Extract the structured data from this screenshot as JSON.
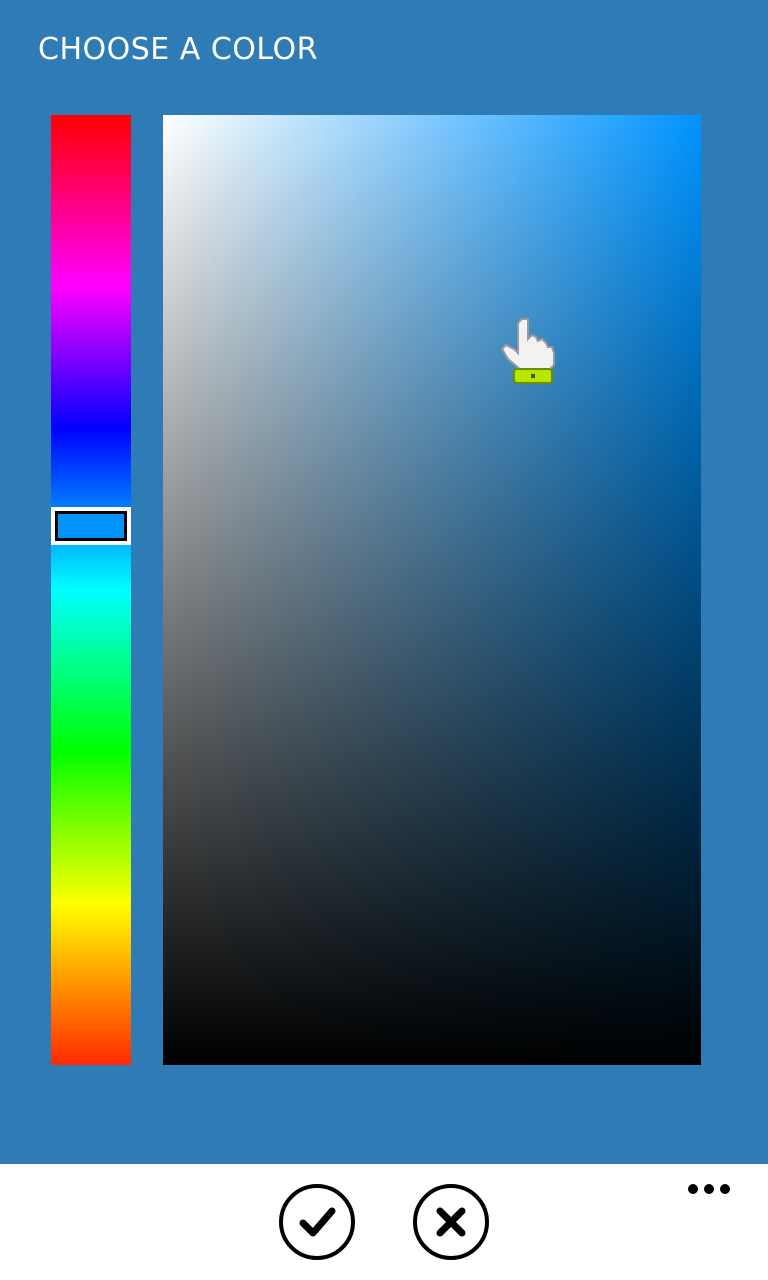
{
  "header": {
    "title": "CHOOSE A COLOR"
  },
  "colors": {
    "background": "#2e7bb5",
    "selected_hue": "#0094ff",
    "app_bar": "#ffffff"
  },
  "hue_slider": {
    "selected_color": "#0094ff"
  },
  "app_bar": {
    "buttons": [
      {
        "name": "accept",
        "icon": "check-icon"
      },
      {
        "name": "cancel",
        "icon": "close-icon"
      }
    ],
    "more_icon": "ellipsis-icon"
  }
}
